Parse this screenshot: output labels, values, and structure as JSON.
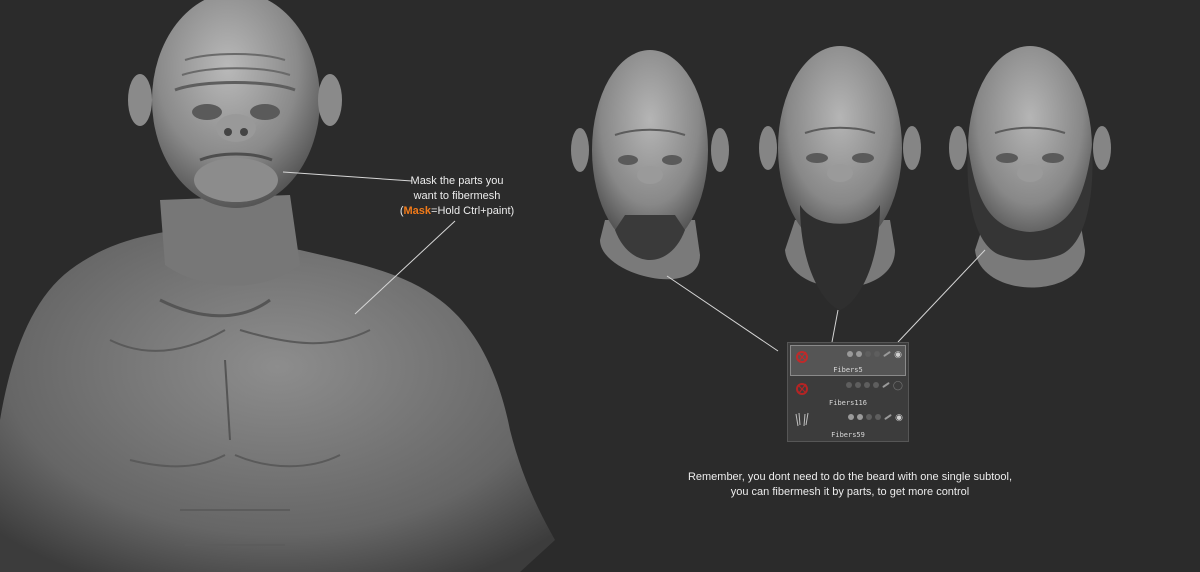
{
  "annotations": {
    "mask_note": {
      "line1": "Mask the parts you",
      "line2": "want to fibermesh",
      "line3_open": "(",
      "line3_accent": "Mask",
      "line3_rest": "=Hold Ctrl+paint)"
    },
    "bottom_note": {
      "line1": "Remember, you dont need to do the beard with one single subtool,",
      "line2": "you can fibermesh it by parts, to get more control"
    }
  },
  "subtool_panel": {
    "items": [
      {
        "name": "Fibers5",
        "active": true
      },
      {
        "name": "Fibers116",
        "active": false
      },
      {
        "name": "Fibers59",
        "active": false
      }
    ]
  },
  "colors": {
    "background": "#2b2b2b",
    "accent": "#f07a1a",
    "clay": "#8e8e8e"
  }
}
